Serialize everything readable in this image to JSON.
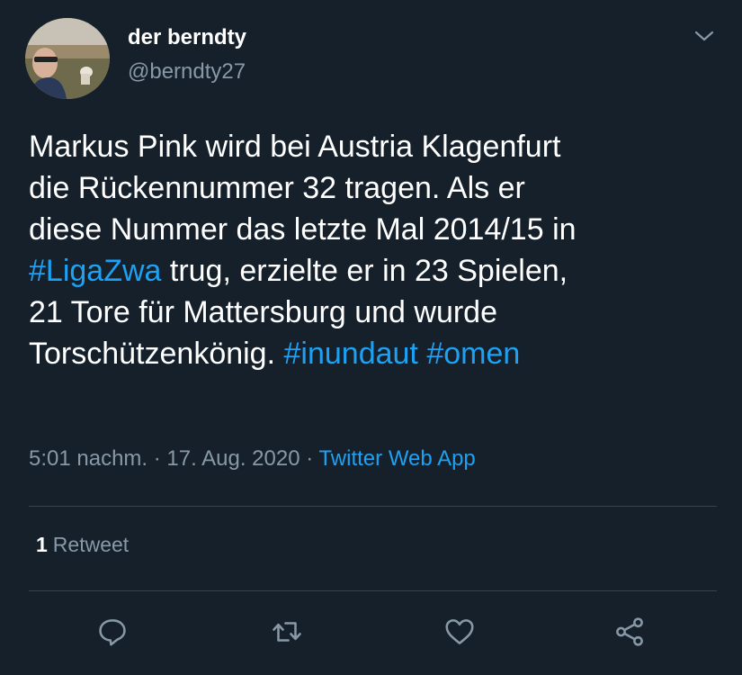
{
  "author": {
    "display_name": "der berndty",
    "handle": "@berndty27"
  },
  "tweet": {
    "line1": "Markus Pink wird bei Austria Klagenfurt",
    "line2": "die Rückennummer 32 tragen. Als er",
    "line3": "diese Nummer das letzte Mal 2014/15 in",
    "line4_hashtag": "#LigaZwa",
    "line4_rest": " trug, erzielte er in 23 Spielen,",
    "line5": "21 Tore für Mattersburg und wurde",
    "line6_text": "Torschützenkönig. ",
    "line6_hashtag1": "#inundaut",
    "line6_hashtag2": "#omen"
  },
  "meta": {
    "time": "5:01 nachm.",
    "sep1": " · ",
    "date": "17. Aug. 2020",
    "sep2": " · ",
    "source": "Twitter Web App"
  },
  "stats": {
    "retweet_count": "1",
    "retweet_label": "Retweet"
  },
  "icons": {
    "caret": "chevron-down-icon",
    "reply": "reply-icon",
    "retweet": "retweet-icon",
    "like": "heart-icon",
    "share": "share-icon"
  },
  "colors": {
    "background": "#15202b",
    "text": "#ffffff",
    "secondary": "#8899a6",
    "link": "#1da1f2",
    "divider": "#38444d"
  }
}
